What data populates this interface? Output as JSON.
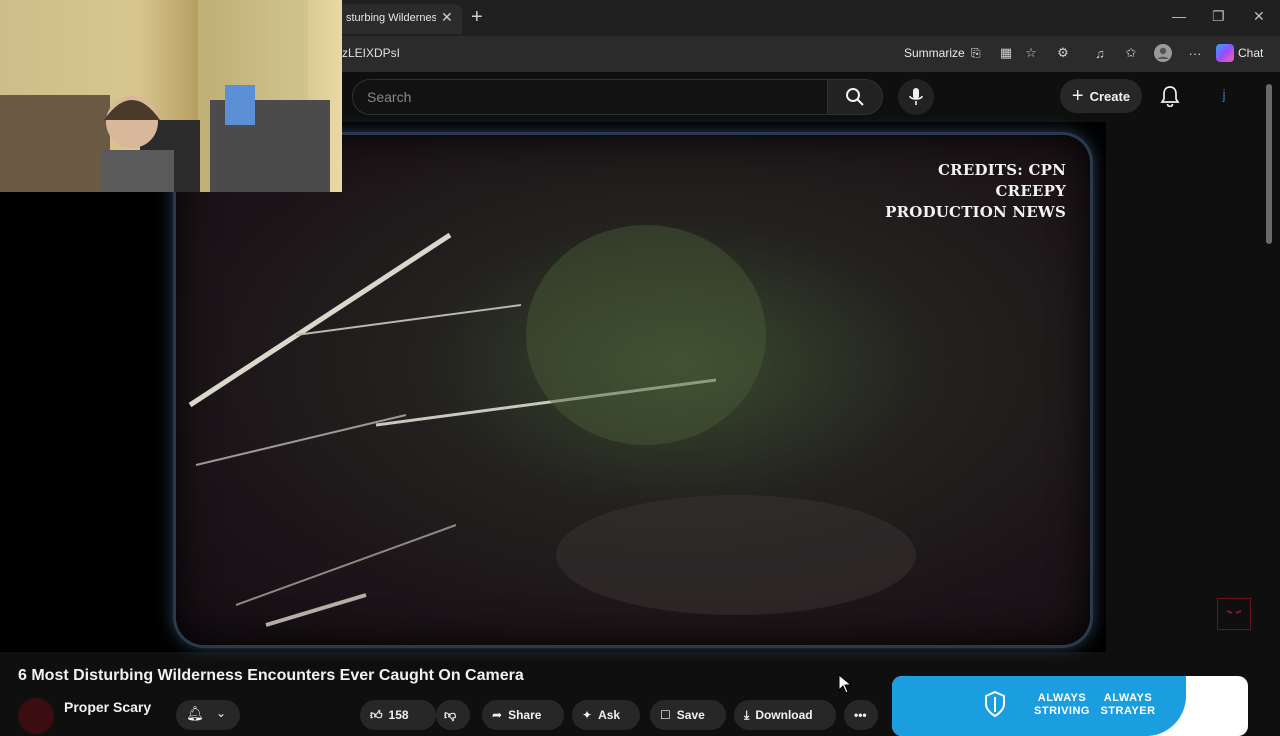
{
  "browser": {
    "tab_title": "sturbing Wilderness",
    "url_fragment": "zLEIXDPsI",
    "summarize_label": "Summarize",
    "chat_label": "Chat"
  },
  "header": {
    "search_placeholder": "Search",
    "create_label": "Create"
  },
  "player": {
    "credits_line1": "CREDITS: CPN CREEPY",
    "credits_line2": "PRODUCTION NEWS"
  },
  "video": {
    "title": "6 Most Disturbing Wilderness Encounters Ever Caught On Camera",
    "channel_name": "Proper Scary",
    "like_count": "158",
    "share_label": "Share",
    "ask_label": "Ask",
    "save_label": "Save",
    "download_label": "Download"
  },
  "ad": {
    "left_text": "ALWAYS STRIVING",
    "right_text": "ALWAYS STRAYER"
  },
  "colors": {
    "background": "#0f0f0f",
    "ad_blue": "#1a9ee0",
    "frame_glow": "#3b5673"
  }
}
